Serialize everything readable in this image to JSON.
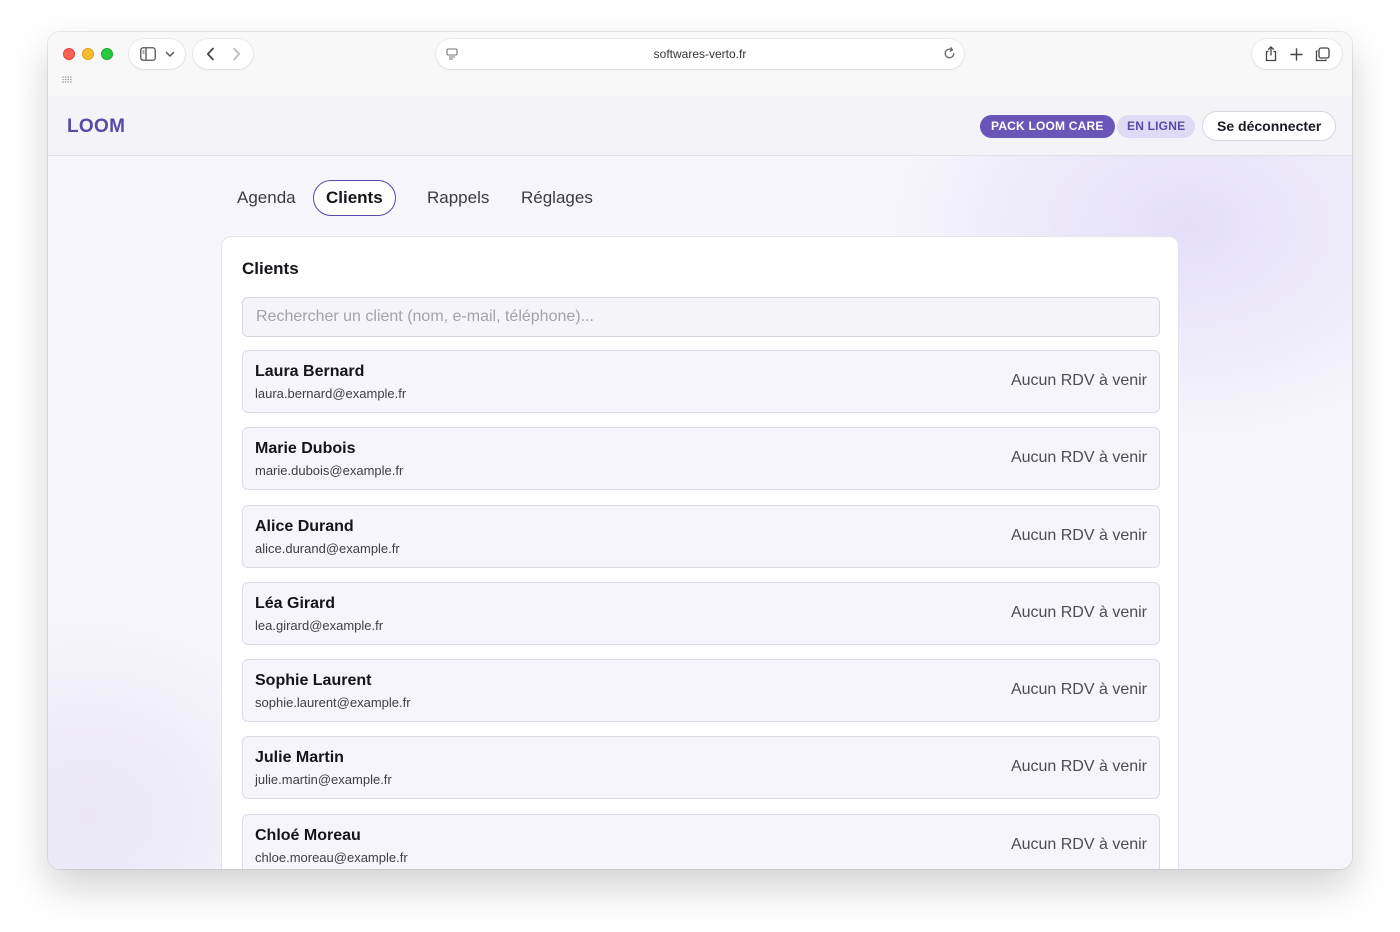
{
  "browser": {
    "url": "softwares-verto.fr",
    "icons": {
      "sidebar": "sidebar-icon",
      "chevron": "chevron-down-icon",
      "back": "back-arrow-icon",
      "forward": "forward-arrow-icon",
      "share": "share-icon",
      "new_tab": "plus-icon",
      "tabs": "tabs-overview-icon",
      "reload": "reload-icon"
    }
  },
  "header": {
    "brand": "LOOM",
    "pack_badge": "PACK LOOM CARE",
    "status_badge": "EN LIGNE",
    "logout_label": "Se déconnecter"
  },
  "tabs": [
    {
      "label": "Agenda",
      "active": false
    },
    {
      "label": "Clients",
      "active": true
    },
    {
      "label": "Rappels",
      "active": false
    },
    {
      "label": "Réglages",
      "active": false
    }
  ],
  "clients_panel": {
    "title": "Clients",
    "search_placeholder": "Rechercher un client (nom, e-mail, téléphone)...",
    "clients": [
      {
        "name": "Laura Bernard",
        "email": "laura.bernard@example.fr",
        "status": "Aucun RDV à venir"
      },
      {
        "name": "Marie Dubois",
        "email": "marie.dubois@example.fr",
        "status": "Aucun RDV à venir"
      },
      {
        "name": "Alice Durand",
        "email": "alice.durand@example.fr",
        "status": "Aucun RDV à venir"
      },
      {
        "name": "Léa Girard",
        "email": "lea.girard@example.fr",
        "status": "Aucun RDV à venir"
      },
      {
        "name": "Sophie Laurent",
        "email": "sophie.laurent@example.fr",
        "status": "Aucun RDV à venir"
      },
      {
        "name": "Julie Martin",
        "email": "julie.martin@example.fr",
        "status": "Aucun RDV à venir"
      },
      {
        "name": "Chloé Moreau",
        "email": "chloe.moreau@example.fr",
        "status": "Aucun RDV à venir"
      }
    ]
  },
  "colors": {
    "brand": "#5a49a8",
    "pack_badge_bg": "#6a55b8",
    "online_badge_bg": "#e0dbf4"
  }
}
